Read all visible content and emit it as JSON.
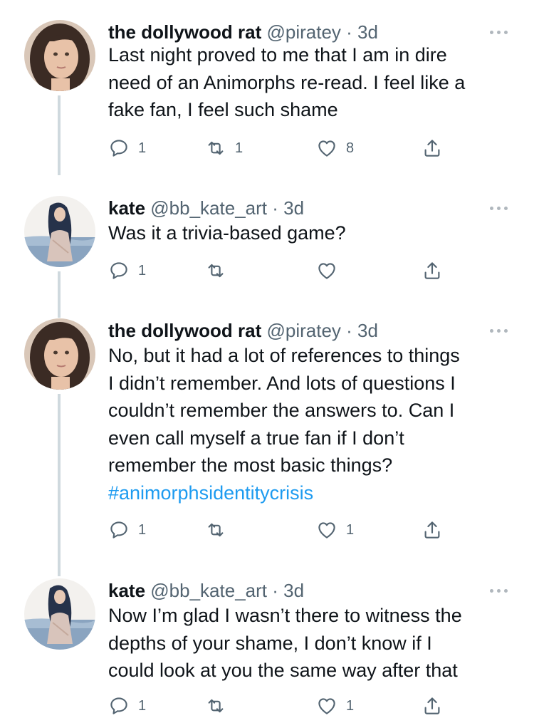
{
  "tweets": [
    {
      "author": "the dollywood rat",
      "handle": "@piratey",
      "dot": "·",
      "time": "3d",
      "lines": [
        "Last night proved to me that I am in dire",
        "need of an Animorphs re-read. I feel like a",
        "fake fan, I feel such shame"
      ],
      "hashtag": "",
      "reply_count": "1",
      "retweet_count": "1",
      "like_count": "8",
      "avatar_icon": "avatar-dark-hair-woman-icon"
    },
    {
      "author": "kate",
      "handle": "@bb_kate_art",
      "dot": "·",
      "time": "3d",
      "lines": [
        "Was it a trivia-based game?"
      ],
      "hashtag": "",
      "reply_count": "1",
      "retweet_count": "",
      "like_count": "",
      "avatar_icon": "avatar-illustrated-woman-icon"
    },
    {
      "author": "the dollywood rat",
      "handle": "@piratey",
      "dot": "·",
      "time": "3d",
      "lines": [
        "No, but it had a lot of references to things",
        "I didn’t remember. And lots of questions I",
        "couldn’t remember the answers to. Can I",
        "even call myself a true fan if I don’t",
        "remember the most basic things?"
      ],
      "hashtag": "#animorphsidentitycrisis",
      "reply_count": "1",
      "retweet_count": "",
      "like_count": "1",
      "avatar_icon": "avatar-dark-hair-woman-icon"
    },
    {
      "author": "kate",
      "handle": "@bb_kate_art",
      "dot": "·",
      "time": "3d",
      "lines": [
        "Now I’m glad I wasn’t there to witness the",
        "depths of your shame, I don’t know if I",
        "could look at you the same way after that"
      ],
      "hashtag": "",
      "reply_count": "1",
      "retweet_count": "",
      "like_count": "1",
      "avatar_icon": "avatar-illustrated-woman-icon"
    }
  ],
  "colors": {
    "text": "#0f1419",
    "secondary": "#536471",
    "link": "#1d9bf0",
    "thread_line": "#cfd9de"
  }
}
